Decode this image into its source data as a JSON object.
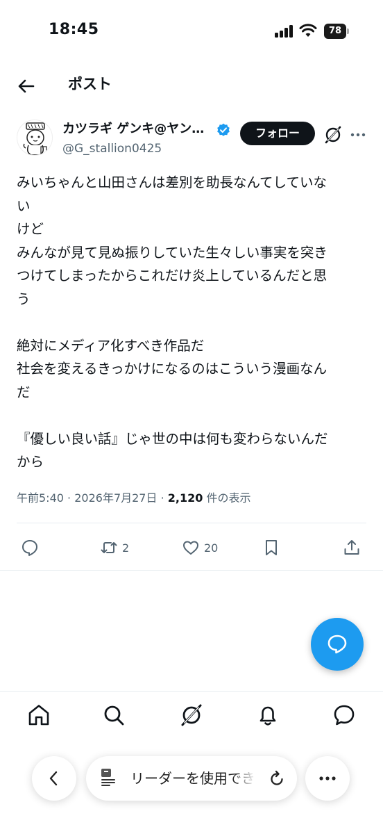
{
  "status_bar": {
    "time": "18:45",
    "battery": "78"
  },
  "header": {
    "title": "ポスト"
  },
  "author": {
    "display_name": "カツラギ ゲンキ@ヤンマガWeb",
    "handle": "@G_stallion0425",
    "follow_label": "フォロー"
  },
  "post": {
    "text": "みいちゃんと山田さんは差別を助長なんてしていな\nい\nけど\nみんなが見て見ぬ振りしていた生々しい事実を突き\nつけてしまったからこれだけ炎上しているんだと思\nう\n\n絶対にメディア化すべき作品だ\n社会を変えるきっかけになるのはこういう漫画なん\nだ\n\n『優しい良い話』じゃ世の中は何も変わらないんだ\nから",
    "time": "午前5:40",
    "date": "2026年7月27日",
    "views_count": "2,120",
    "views_label": "件の表示",
    "separator": "·"
  },
  "actions": {
    "reply_count": "",
    "repost_count": "2",
    "like_count": "20"
  },
  "browser": {
    "url_text": "リーダーを使用できます"
  },
  "colors": {
    "accent": "#1d9bf0",
    "text": "#0f1419",
    "muted": "#536471"
  }
}
